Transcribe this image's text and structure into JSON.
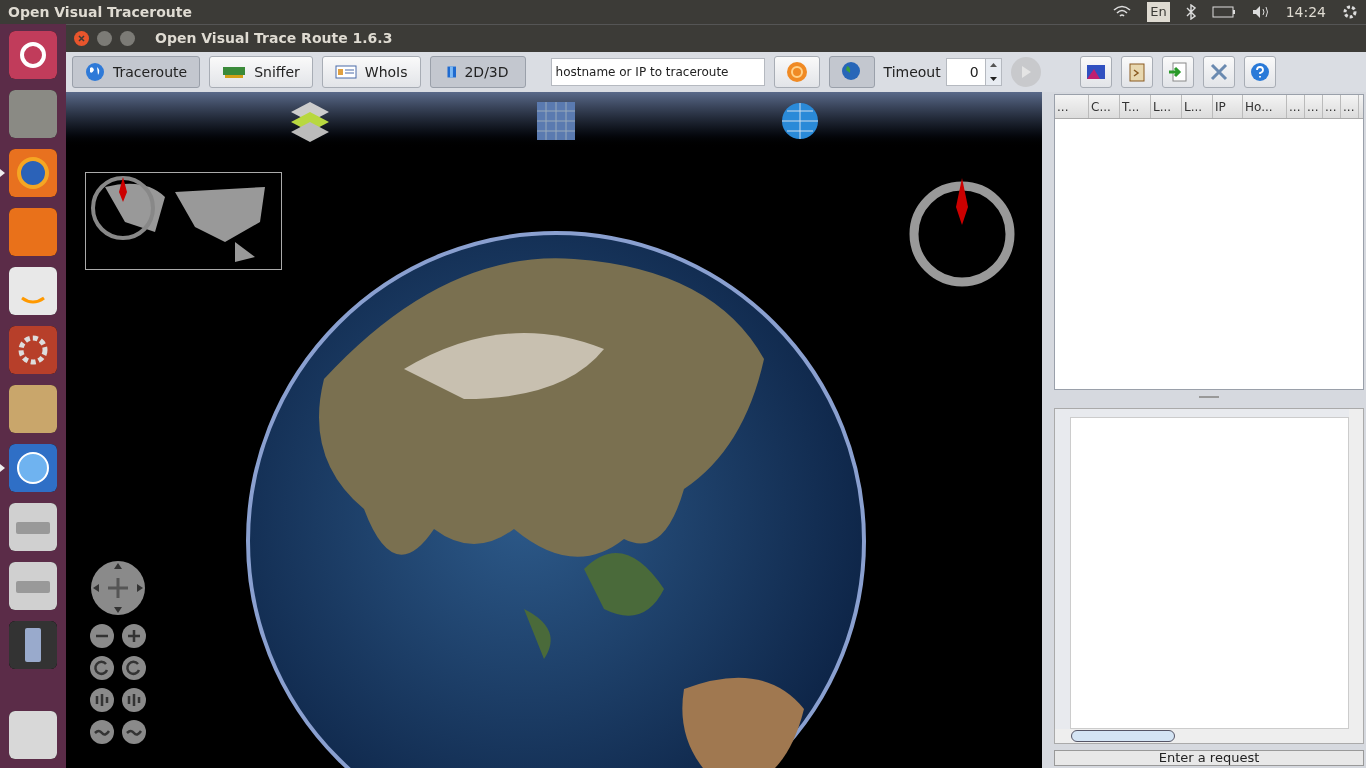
{
  "top_panel": {
    "title": "Open Visual Traceroute",
    "keyboard": "En",
    "clock": "14:24"
  },
  "launcher": [
    {
      "kind": "ubuntu",
      "running": false
    },
    {
      "kind": "files",
      "running": false
    },
    {
      "kind": "firefox",
      "running": true
    },
    {
      "kind": "store",
      "running": false
    },
    {
      "kind": "amazon",
      "running": false
    },
    {
      "kind": "settings",
      "running": false
    },
    {
      "kind": "archive",
      "running": false
    },
    {
      "kind": "globe",
      "running": true
    },
    {
      "kind": "drive",
      "running": false
    },
    {
      "kind": "drive",
      "running": false
    },
    {
      "kind": "phone",
      "running": false
    },
    {
      "kind": "trash",
      "running": false
    }
  ],
  "window": {
    "title": "Open Visual Trace Route 1.6.3"
  },
  "tabs": [
    {
      "label": "Traceroute",
      "selected": true
    },
    {
      "label": "Sniffer",
      "selected": false
    },
    {
      "label": "WhoIs",
      "selected": false
    }
  ],
  "view_toggle": {
    "label": "2D/3D",
    "on": true
  },
  "search": {
    "placeholder": "hostname or IP to traceroute"
  },
  "resolve_toggle": {
    "on": true
  },
  "timeout": {
    "label": "Timeout",
    "value": "0"
  },
  "table": {
    "columns": [
      "...",
      "C...",
      "T...",
      "L...",
      "L...",
      "IP",
      "Ho...",
      "...",
      "...",
      "...",
      "..."
    ]
  },
  "status_bar": "Enter a request"
}
